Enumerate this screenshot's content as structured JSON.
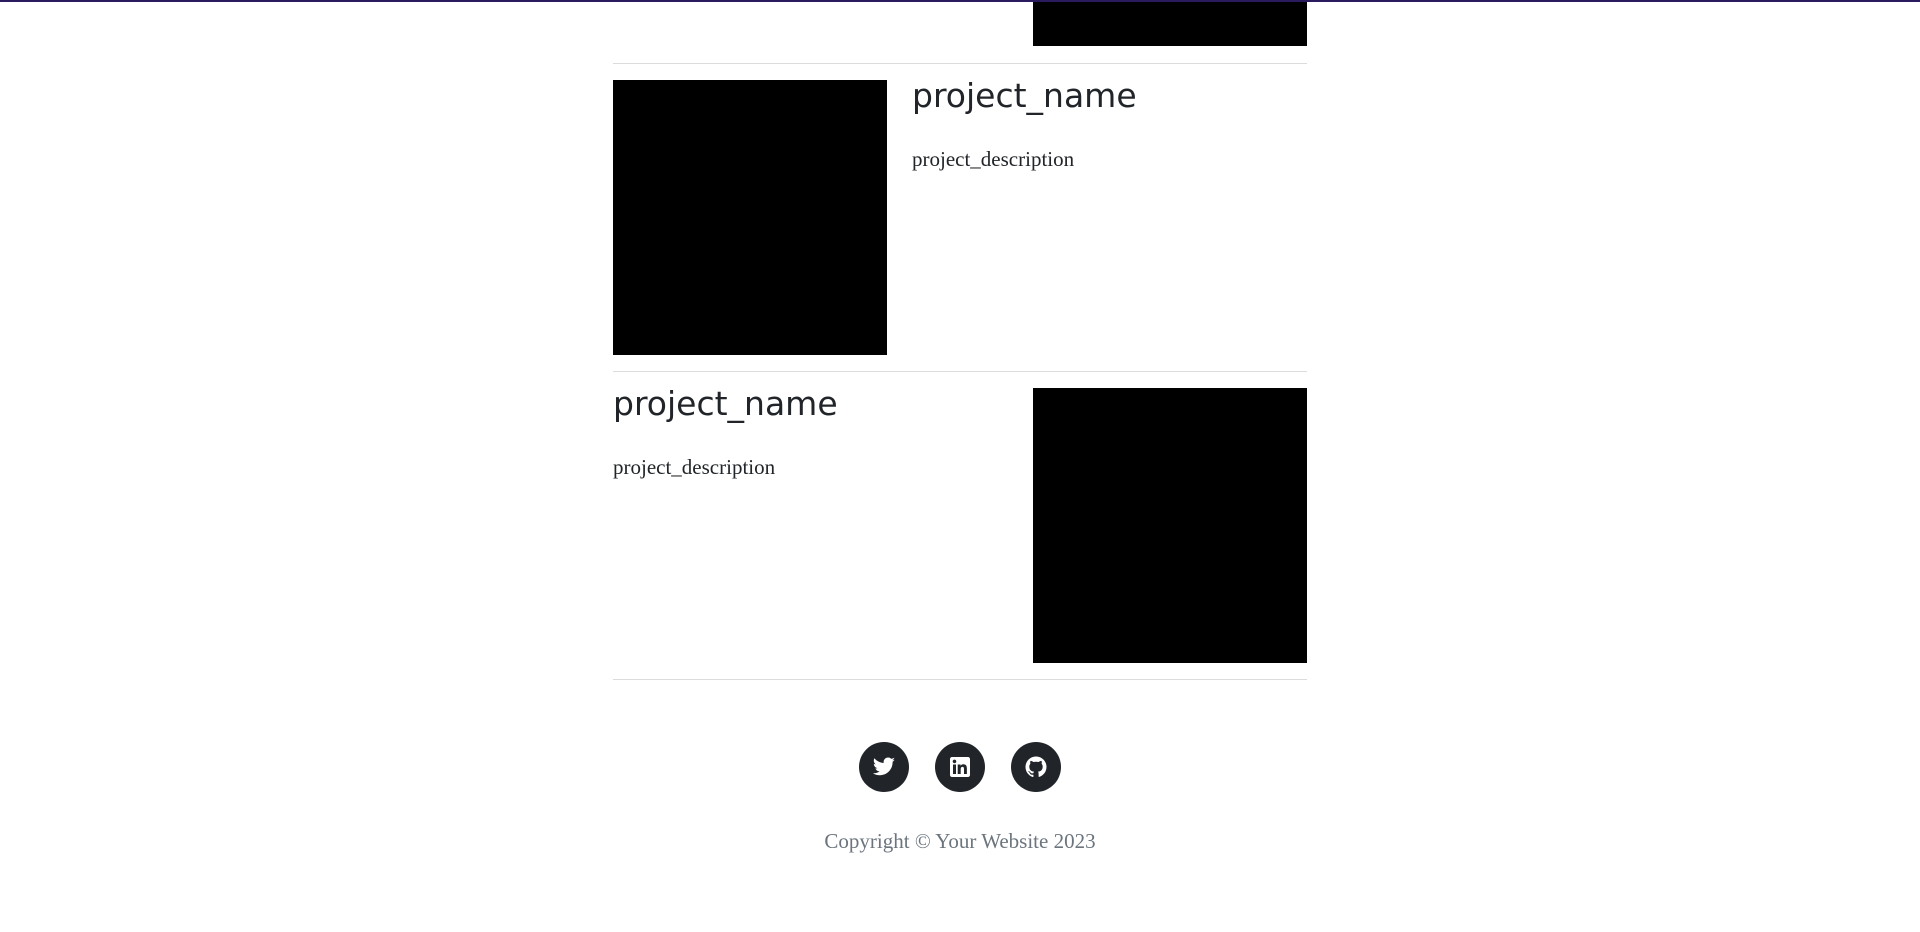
{
  "projects": [
    {
      "name": "project_name",
      "description": "project_description"
    },
    {
      "name": "project_name",
      "description": "project_description"
    }
  ],
  "footer": {
    "social": [
      {
        "name": "twitter",
        "icon": "twitter-icon"
      },
      {
        "name": "linkedin",
        "icon": "linkedin-icon"
      },
      {
        "name": "github",
        "icon": "github-icon"
      }
    ],
    "copyright": "Copyright © Your Website 2023"
  },
  "colors": {
    "accent_bar": "#2a1a5e",
    "text": "#212529",
    "muted": "#6c757d",
    "divider": "#dcdcdc"
  }
}
